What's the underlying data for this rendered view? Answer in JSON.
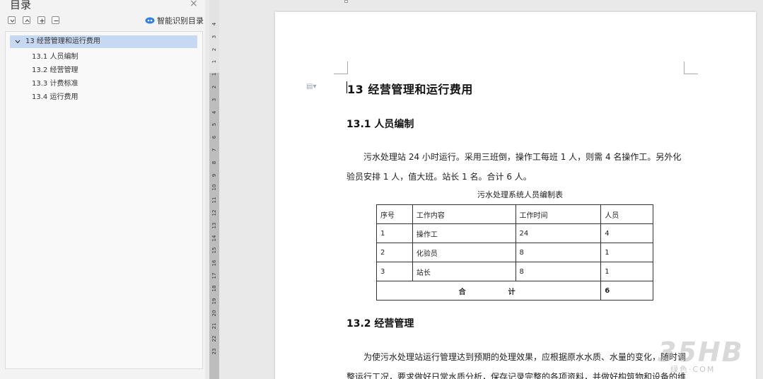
{
  "sidebar": {
    "title": "目录",
    "close": "×",
    "smart_toc": "智能识别目录",
    "tools": [
      "collapse-all-icon",
      "expand-up-icon",
      "add-level-icon",
      "remove-level-icon"
    ],
    "toc_items": [
      {
        "label": "13  经营管理和运行费用",
        "level": 1,
        "selected": true
      },
      {
        "label": "13.1  人员编制",
        "level": 2
      },
      {
        "label": "13.2  经营管理",
        "level": 2
      },
      {
        "label": "13.3  计费标准",
        "level": 2
      },
      {
        "label": "13.4  运行费用",
        "level": 2
      }
    ]
  },
  "ruler": {
    "numbers": [
      "4",
      "3",
      "2",
      "1",
      "1",
      "2",
      "3",
      "4",
      "5",
      "6",
      "7",
      "8",
      "9",
      "10",
      "11",
      "12",
      "13",
      "14",
      "15",
      "16",
      "17",
      "18",
      "19",
      "20",
      "21",
      "22",
      "23"
    ]
  },
  "document": {
    "heading1": "13  经营管理和运行费用",
    "section_a": "13.1  人员编制",
    "para1": "污水处理站 24 小时运行。采用三班倒，操作工每班 1 人，则需 4 名操作工。另外化验员安排 1 人，值大班。站长 1 名。合计 6 人。",
    "table_caption": "污水处理系统人员编制表",
    "table": {
      "headers": [
        "序号",
        "工作内容",
        "工作时间",
        "人员"
      ],
      "rows": [
        [
          "1",
          "操作工",
          "24",
          "4"
        ],
        [
          "2",
          "化验员",
          "8",
          "1"
        ],
        [
          "3",
          "站长",
          "8",
          "1"
        ]
      ],
      "total_label": "合计",
      "total_value": "6"
    },
    "section_b": "13.2  经营管理",
    "para2": "为使污水处理站运行管理达到预期的处理效果，应根据原水水质、水量的变化，随时调整运行工况，要求做好日常水质分析，保存记录完整的各项资料，并做好构筑物和设备的维"
  },
  "watermark": {
    "logo": "35HB",
    "sub": "绿色·COM"
  },
  "colors": {
    "selected": "#c7d8f2",
    "accent": "#2f7fe0"
  }
}
